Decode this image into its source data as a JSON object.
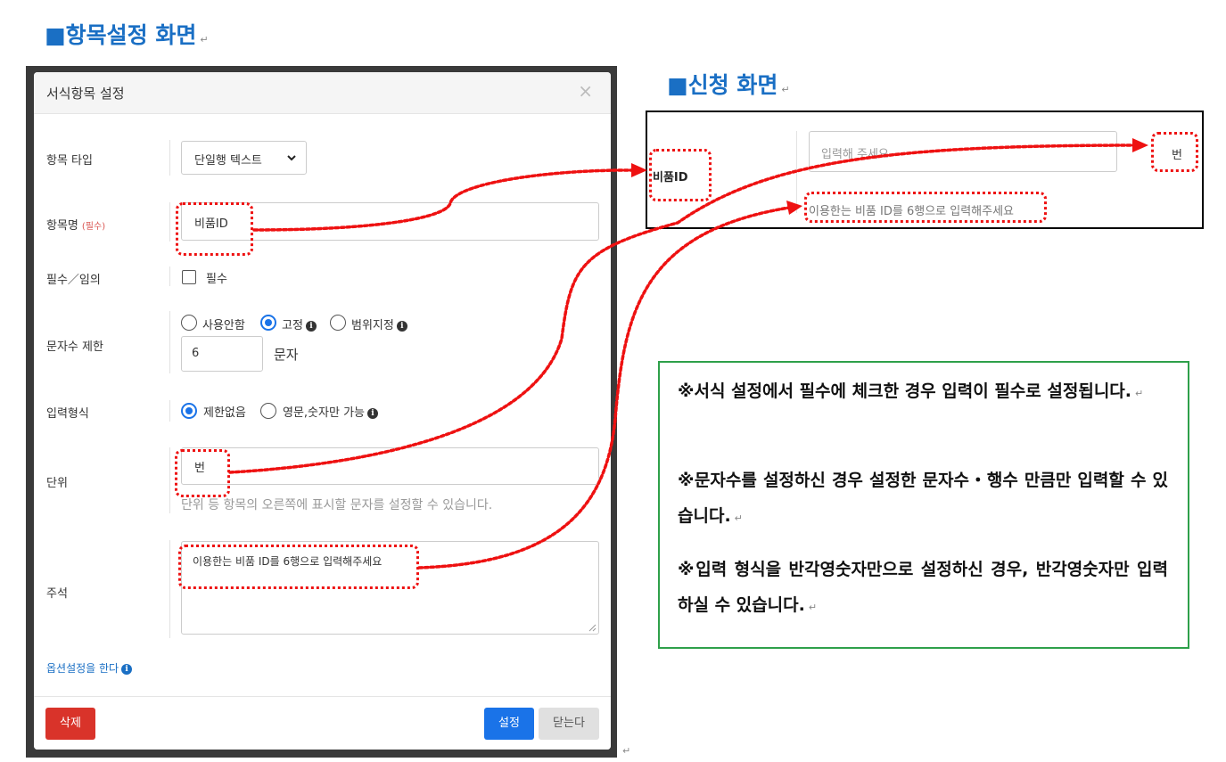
{
  "headings": {
    "settings_screen": "■항목설정 화면",
    "application_screen": "■신청 화면",
    "para_mark": "↵"
  },
  "modal": {
    "title": "서식항목 설정",
    "close_glyph": "×",
    "rows": {
      "item_type": {
        "label": "항목 타입",
        "select_value": "단일행 텍스트"
      },
      "item_name": {
        "label": "항목명",
        "required_tag": "(필수)",
        "value": "비품ID"
      },
      "required_optional": {
        "label": "필수／임의",
        "checkbox_label": "필수",
        "checked": false
      },
      "char_limit": {
        "label": "문자수 제한",
        "options": [
          "사용안함",
          "고정",
          "범위지정"
        ],
        "selected": "고정",
        "value": "6",
        "unit_label": "문자"
      },
      "input_format": {
        "label": "입력형식",
        "options": [
          "제한없음",
          "영문,숫자만 가능"
        ],
        "selected": "제한없음"
      },
      "unit": {
        "label": "단위",
        "value": "번",
        "help": "단위 등 항목의 오른쪽에 표시할 문자를 설정할 수 있습니다."
      },
      "annotation": {
        "label": "주석",
        "value": "이용한는 비품 ID를 6행으로 입력해주세요"
      }
    },
    "option_link": "옵션설정을 한다",
    "footer": {
      "delete": "삭제",
      "save": "설정",
      "close": "닫는다"
    }
  },
  "application": {
    "label": "비품ID",
    "placeholder": "입력해 주세요",
    "unit": "번",
    "note": "이용한는 비품 ID를 6행으로 입력해주세요"
  },
  "notes": [
    "※서식 설정에서 필수에 체크한 경우 입력이 필수로 설정됩니다.",
    "※문자수를 설정하신 경우 설정한 문자수・행수 만큼만 입력할 수 있습니다.",
    "※입력 형식을 반각영숫자만으로 설정하신 경우, 반각영숫자만 입력하실 수 있습니다."
  ],
  "icons": {
    "info": "info-circle-icon",
    "chevron": "chevron-down-icon",
    "arrow": "arrowhead-icon"
  },
  "colors": {
    "heading": "#1a6fc4",
    "highlight": "#ee1111",
    "primary_button": "#1a73e8",
    "danger_button": "#d9332a",
    "note_border": "#2ea04a"
  }
}
